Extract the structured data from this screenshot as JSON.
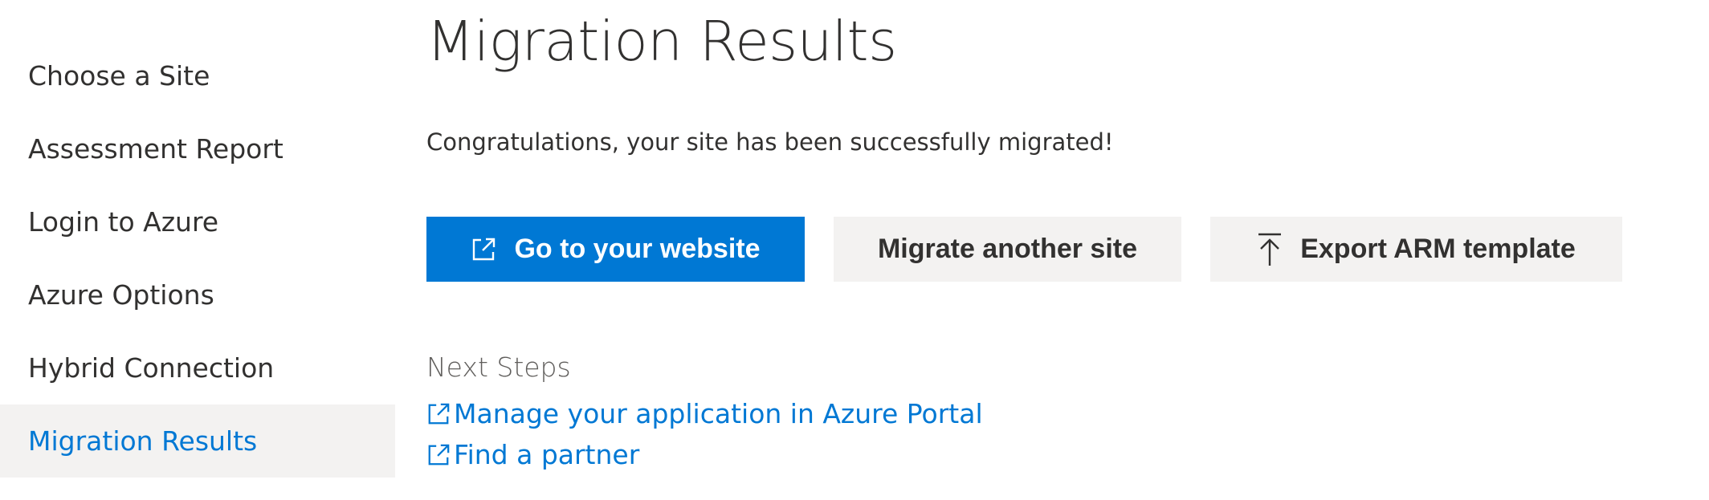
{
  "sidebar": {
    "items": [
      {
        "label": "Choose a Site"
      },
      {
        "label": "Assessment Report"
      },
      {
        "label": "Login to Azure"
      },
      {
        "label": "Azure Options"
      },
      {
        "label": "Hybrid Connection"
      },
      {
        "label": "Migration Results",
        "active": true
      }
    ]
  },
  "main": {
    "title": "Migration Results",
    "message": "Congratulations, your site has been successfully migrated!",
    "buttons": {
      "go_to_website": {
        "label": "Go to your website",
        "icon": "external-link-icon"
      },
      "migrate_another": {
        "label": "Migrate another site"
      },
      "export_arm": {
        "label": "Export ARM template",
        "icon": "upload-arrow-icon"
      }
    },
    "next_steps": {
      "title": "Next Steps",
      "links": [
        {
          "label": "Manage your application in Azure Portal",
          "icon": "external-link-icon"
        },
        {
          "label": "Find a partner",
          "icon": "external-link-icon"
        }
      ]
    }
  },
  "colors": {
    "accent": "#0078d4",
    "text": "#323130",
    "secondary_bg": "#f3f2f1",
    "muted_text": "#605e5c"
  }
}
